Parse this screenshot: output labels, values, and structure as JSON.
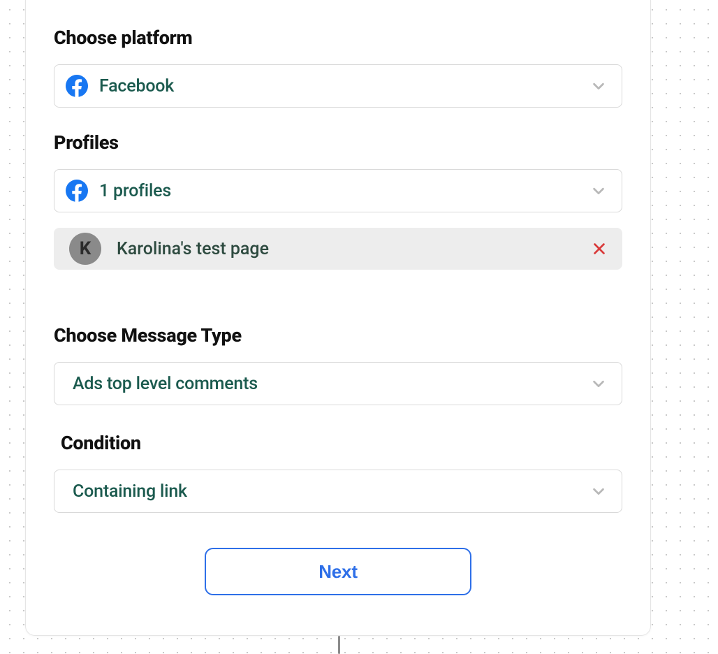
{
  "sections": {
    "platform": {
      "heading": "Choose platform",
      "selected": "Facebook"
    },
    "profiles": {
      "heading": "Profiles",
      "selected": "1 profiles",
      "items": [
        {
          "initial": "K",
          "name": "Karolina's test page"
        }
      ]
    },
    "messageType": {
      "heading": "Choose Message Type",
      "selected": "Ads top level comments"
    },
    "condition": {
      "heading": "Condition",
      "selected": "Containing link"
    }
  },
  "buttons": {
    "next": "Next"
  },
  "colors": {
    "chevron": "#b8b8b8",
    "close": "#d93a3a",
    "fbBlue": "#1877F2",
    "primaryBlue": "#2e6fe8"
  }
}
